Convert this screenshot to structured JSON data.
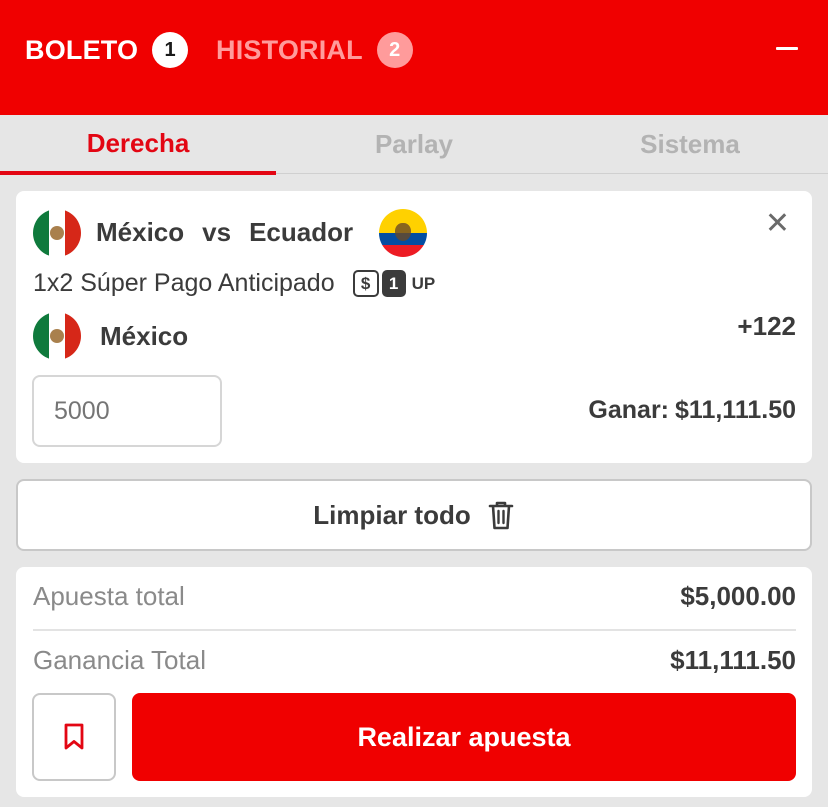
{
  "colors": {
    "brand_red": "#f00000",
    "tab_active": "#e30613",
    "text_dark": "#3b3b3b",
    "text_muted": "#8a8a8a"
  },
  "header": {
    "tabs": [
      {
        "label": "BOLETO",
        "count": "1"
      },
      {
        "label": "HISTORIAL",
        "count": "2"
      }
    ],
    "minimize_icon": "minus-icon"
  },
  "bet_types": {
    "tabs": [
      "Derecha",
      "Parlay",
      "Sistema"
    ],
    "active": "Derecha"
  },
  "selection": {
    "home_team": "México",
    "vs": "vs",
    "away_team": "Ecuador",
    "market": "1x2 Súper Pago Anticipado",
    "boost_badge": {
      "symbol": "$",
      "number": "1",
      "suffix": "UP"
    },
    "pick": "México",
    "odds": "+122",
    "stake_placeholder": "5000",
    "to_win_label": "Ganar:",
    "to_win_value": "$11,111.50"
  },
  "clear_all": {
    "label": "Limpiar todo",
    "icon": "trash-icon"
  },
  "summary": {
    "total_stake_label": "Apuesta total",
    "total_stake_value": "$5,000.00",
    "total_win_label": "Ganancia Total",
    "total_win_value": "$11,111.50",
    "bookmark_icon": "bookmark-icon",
    "place_bet_label": "Realizar apuesta"
  }
}
